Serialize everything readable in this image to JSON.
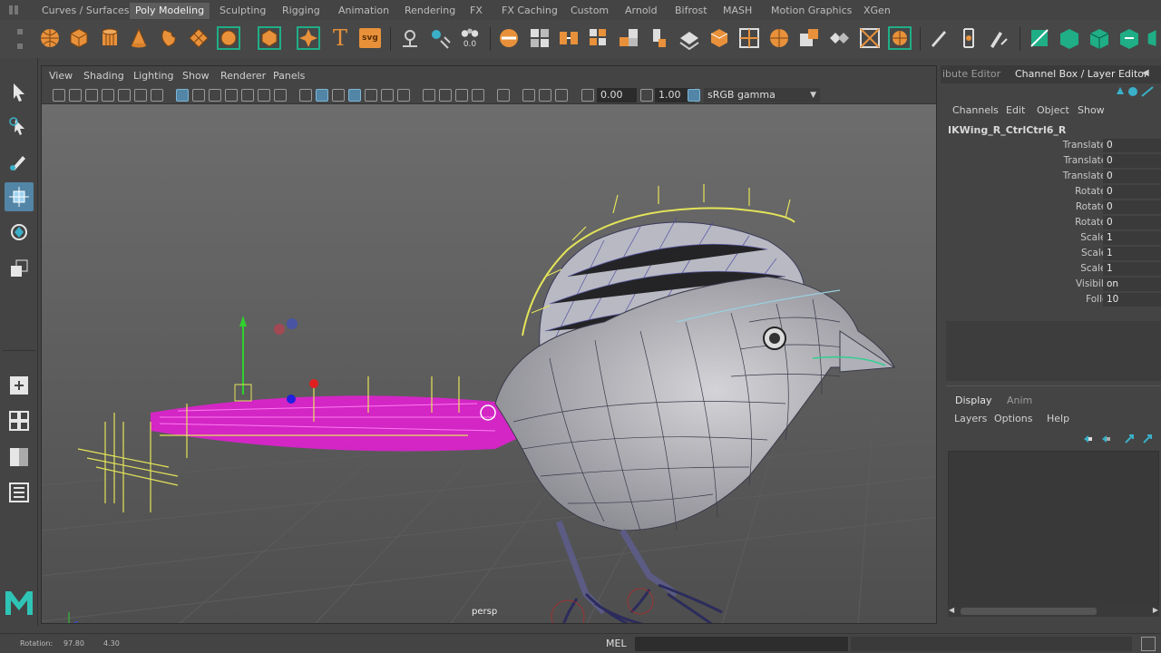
{
  "shelf": {
    "tabs": [
      {
        "label": "Curves / Surfaces"
      },
      {
        "label": "Poly Modeling"
      },
      {
        "label": "Sculpting"
      },
      {
        "label": "Rigging"
      },
      {
        "label": "Animation"
      },
      {
        "label": "Rendering"
      },
      {
        "label": "FX"
      },
      {
        "label": "FX Caching"
      },
      {
        "label": "Custom"
      },
      {
        "label": "Arnold"
      },
      {
        "label": "Bifrost"
      },
      {
        "label": "MASH"
      },
      {
        "label": "Motion Graphics"
      },
      {
        "label": "XGen"
      }
    ],
    "active_tab": "Poly Modeling",
    "text_tool_label": "T",
    "svg_tool_label": "svg",
    "digits_label": "0.0"
  },
  "viewport": {
    "menu": [
      "View",
      "Shading",
      "Lighting",
      "Show",
      "Renderer",
      "Panels"
    ],
    "field_a": "0.00",
    "field_b": "1.00",
    "color_space": "sRGB gamma",
    "camera_label": "persp"
  },
  "right_panel": {
    "tab_attribute": "ibute Editor",
    "tab_channel": "Channel Box / Layer Editor",
    "channel_menu": [
      "Channels",
      "Edit",
      "Object",
      "Show"
    ],
    "node_name": "IKWing_R_CtrlCtrl6_R",
    "channels": [
      {
        "label": "Translate X",
        "value": "0"
      },
      {
        "label": "Translate Y",
        "value": "0"
      },
      {
        "label": "Translate Z",
        "value": "0"
      },
      {
        "label": "Rotate X",
        "value": "0"
      },
      {
        "label": "Rotate Y",
        "value": "0"
      },
      {
        "label": "Rotate Z",
        "value": "0"
      },
      {
        "label": "Scale X",
        "value": "1"
      },
      {
        "label": "Scale Y",
        "value": "1"
      },
      {
        "label": "Scale Z",
        "value": "1"
      },
      {
        "label": "Visibility",
        "value": "on"
      },
      {
        "label": "Follow",
        "value": "10"
      }
    ],
    "layer_tabs": [
      "Display",
      "Anim"
    ],
    "layer_menu": [
      "Layers",
      "Options",
      "Help"
    ]
  },
  "status": {
    "rotation_label": "Rotation:",
    "rotation_a": "97.80",
    "rotation_b": "4.30",
    "mel_label": "MEL"
  },
  "colors": {
    "accent": "#5285a6",
    "shelf_orange": "#e8913a",
    "shelf_green": "#1fae86",
    "selection_magenta": "#e020d0",
    "controller_yellow": "#e3e35a"
  },
  "icons": {
    "toolbox": [
      "select-arrow-icon",
      "lasso-select-icon",
      "paint-select-icon",
      "move-icon",
      "rotate-icon",
      "scale-icon",
      "single-view-icon",
      "four-view-icon",
      "two-view-icon",
      "outliner-icon"
    ],
    "maya": "maya-logo-icon"
  }
}
